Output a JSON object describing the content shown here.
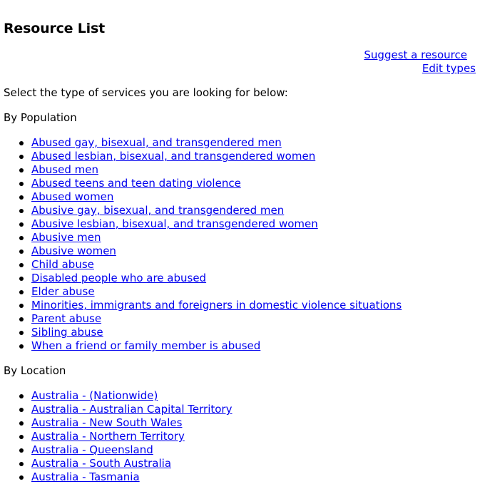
{
  "page": {
    "title": "Resource List"
  },
  "actions": {
    "suggest_resource": "Suggest a resource",
    "edit_types": "Edit types"
  },
  "intro_text": "Select the type of services you are looking for below:",
  "sections": {
    "population": {
      "heading": "By Population",
      "items": [
        "Abused gay, bisexual, and transgendered men",
        "Abused lesbian, bisexual, and transgendered women",
        "Abused men",
        "Abused teens and teen dating violence",
        "Abused women",
        "Abusive gay, bisexual, and transgendered men",
        "Abusive lesbian, bisexual, and transgendered women",
        "Abusive men",
        "Abusive women",
        "Child abuse",
        "Disabled people who are abused",
        "Elder abuse",
        "Minorities, immigrants and foreigners in domestic violence situations",
        "Parent abuse",
        "Sibling abuse",
        "When a friend or family member is abused"
      ]
    },
    "location": {
      "heading": "By Location",
      "items": [
        "Australia - (Nationwide)",
        "Australia - Australian Capital Territory",
        "Australia - New South Wales",
        "Australia - Northern Territory",
        "Australia - Queensland",
        "Australia - South Australia",
        "Australia - Tasmania"
      ]
    }
  },
  "colors": {
    "link": "#0000ee",
    "text": "#000000",
    "background": "#ffffff"
  }
}
